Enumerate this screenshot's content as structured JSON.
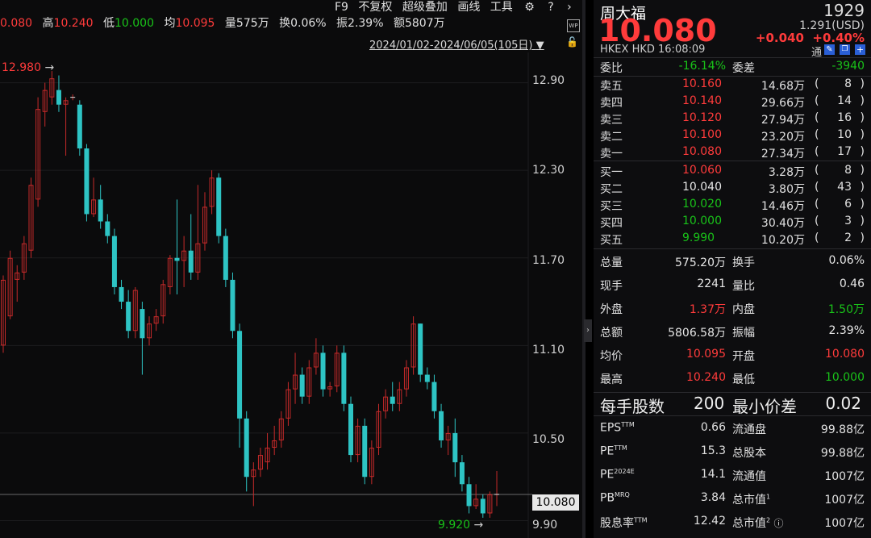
{
  "infobar": {
    "last_label": "",
    "last_value": "0.080",
    "high_label": "高",
    "high_value": "10.240",
    "low_label": "低",
    "low_value": "10.000",
    "avg_label": "均",
    "avg_value": "10.095",
    "vol_label": "量",
    "vol_value": "575万",
    "turn_label": "换",
    "turn_value": "0.06%",
    "amp_label": "振",
    "amp_value": "2.39%",
    "amt_label": "额",
    "amt_value": "5807万"
  },
  "menu": {
    "f9": "F9",
    "adjust": "不复权",
    "overlay": "超级叠加",
    "draw": "画线",
    "tools": "工具"
  },
  "date_range": "2024/01/02-2024/06/05(105日)",
  "price_axis": [
    "12.90",
    "12.30",
    "11.70",
    "11.10",
    "10.50",
    "9.90"
  ],
  "current_price_tag": "10.080",
  "annotations": {
    "max": "12.980",
    "min": "9.920"
  },
  "chart_data": {
    "type": "candlestick",
    "title": "",
    "ylim": [
      9.82,
      13.08
    ],
    "y_ticks": [
      12.9,
      12.3,
      11.7,
      11.1,
      10.5,
      9.9
    ],
    "max_label": 12.98,
    "min_label": 9.92,
    "last": 10.08,
    "candles": [
      [
        11.1,
        11.55,
        11.05,
        11.58
      ],
      [
        11.3,
        11.7,
        11.28,
        11.75
      ],
      [
        11.55,
        11.6,
        11.4,
        11.65
      ],
      [
        11.6,
        11.8,
        11.55,
        11.85
      ],
      [
        11.75,
        12.2,
        11.7,
        12.25
      ],
      [
        12.1,
        12.72,
        12.05,
        12.8
      ],
      [
        12.7,
        12.85,
        12.6,
        12.9
      ],
      [
        12.8,
        12.93,
        12.75,
        12.98
      ],
      [
        12.85,
        12.75,
        12.7,
        12.95
      ],
      [
        12.75,
        12.78,
        12.4,
        12.8
      ],
      [
        12.8,
        12.8,
        12.78,
        12.82
      ],
      [
        12.75,
        12.45,
        12.4,
        12.78
      ],
      [
        12.45,
        12.0,
        11.95,
        12.48
      ],
      [
        12.0,
        12.1,
        11.98,
        12.25
      ],
      [
        12.1,
        11.95,
        11.9,
        12.2
      ],
      [
        11.95,
        11.85,
        11.8,
        12.0
      ],
      [
        11.85,
        11.5,
        11.45,
        11.9
      ],
      [
        11.5,
        11.4,
        11.35,
        11.55
      ],
      [
        11.4,
        11.2,
        11.15,
        11.48
      ],
      [
        11.2,
        11.48,
        11.15,
        11.5
      ],
      [
        11.35,
        11.15,
        10.9,
        11.4
      ],
      [
        11.15,
        11.25,
        11.1,
        11.3
      ],
      [
        11.25,
        11.3,
        11.2,
        11.35
      ],
      [
        11.3,
        11.52,
        11.25,
        11.55
      ],
      [
        11.5,
        11.7,
        11.45,
        11.72
      ],
      [
        11.7,
        11.68,
        11.45,
        12.1
      ],
      [
        11.68,
        11.75,
        11.5,
        11.85
      ],
      [
        11.75,
        11.6,
        11.55,
        12.0
      ],
      [
        11.6,
        11.8,
        11.55,
        12.2
      ],
      [
        11.8,
        12.05,
        11.75,
        12.15
      ],
      [
        12.05,
        12.25,
        12.0,
        12.3
      ],
      [
        12.25,
        11.85,
        11.8,
        12.28
      ],
      [
        11.85,
        11.55,
        11.5,
        11.9
      ],
      [
        11.55,
        11.2,
        11.15,
        11.6
      ],
      [
        11.2,
        10.6,
        10.4,
        11.25
      ],
      [
        10.6,
        10.2,
        10.1,
        10.65
      ],
      [
        10.2,
        10.25,
        10.0,
        10.3
      ],
      [
        10.25,
        10.35,
        10.2,
        10.4
      ],
      [
        10.3,
        10.4,
        10.25,
        10.5
      ],
      [
        10.4,
        10.45,
        10.35,
        10.55
      ],
      [
        10.45,
        10.6,
        10.4,
        10.65
      ],
      [
        10.6,
        10.8,
        10.55,
        10.85
      ],
      [
        10.8,
        10.9,
        10.7,
        11.05
      ],
      [
        10.9,
        10.75,
        10.7,
        10.95
      ],
      [
        10.75,
        10.95,
        10.7,
        11.0
      ],
      [
        10.95,
        11.05,
        10.9,
        11.15
      ],
      [
        11.05,
        10.8,
        10.75,
        11.1
      ],
      [
        10.8,
        10.82,
        10.75,
        10.85
      ],
      [
        10.82,
        11.05,
        10.78,
        11.1
      ],
      [
        11.05,
        10.7,
        10.65,
        11.1
      ],
      [
        10.7,
        10.35,
        10.3,
        10.75
      ],
      [
        10.35,
        10.55,
        10.3,
        10.6
      ],
      [
        10.55,
        10.2,
        10.15,
        10.6
      ],
      [
        10.2,
        10.4,
        10.15,
        10.45
      ],
      [
        10.4,
        10.65,
        10.35,
        10.7
      ],
      [
        10.65,
        10.75,
        10.6,
        10.8
      ],
      [
        10.75,
        10.7,
        10.65,
        10.85
      ],
      [
        10.7,
        10.8,
        10.65,
        10.85
      ],
      [
        10.8,
        10.95,
        10.75,
        11.0
      ],
      [
        10.95,
        11.25,
        10.9,
        11.3
      ],
      [
        11.25,
        10.9,
        10.85,
        11.25
      ],
      [
        10.9,
        10.85,
        10.8,
        10.95
      ],
      [
        10.85,
        10.65,
        10.6,
        10.9
      ],
      [
        10.65,
        10.45,
        10.4,
        10.7
      ],
      [
        10.45,
        10.5,
        10.35,
        10.55
      ],
      [
        10.5,
        10.3,
        10.2,
        10.6
      ],
      [
        10.3,
        10.15,
        10.1,
        10.35
      ],
      [
        10.15,
        10.0,
        9.95,
        10.2
      ],
      [
        10.0,
        10.05,
        9.98,
        10.15
      ],
      [
        10.05,
        9.95,
        9.92,
        10.08
      ],
      [
        9.95,
        10.08,
        9.92,
        10.1
      ],
      [
        10.08,
        10.08,
        10.0,
        10.24
      ]
    ]
  },
  "stock": {
    "name": "周大福",
    "code": "1929",
    "price": "10.080",
    "usd": "1.291(USD)",
    "change": "+0.040",
    "change_pct": "+0.40%",
    "exchange": "HKEX",
    "currency": "HKD",
    "time": "16:08:09",
    "tong": "通"
  },
  "ratio": {
    "l1": "委比",
    "v1": "-16.14%",
    "l2": "委差",
    "v2": "-3940"
  },
  "asks": [
    {
      "label": "卖五",
      "price": "10.160",
      "vol": "14.68万",
      "cnt": "8"
    },
    {
      "label": "卖四",
      "price": "10.140",
      "vol": "29.66万",
      "cnt": "14"
    },
    {
      "label": "卖三",
      "price": "10.120",
      "vol": "27.94万",
      "cnt": "16"
    },
    {
      "label": "卖二",
      "price": "10.100",
      "vol": "23.20万",
      "cnt": "10"
    },
    {
      "label": "卖一",
      "price": "10.080",
      "vol": "27.34万",
      "cnt": "17"
    }
  ],
  "bids": [
    {
      "label": "买一",
      "price": "10.060",
      "vol": "3.28万",
      "cnt": "8"
    },
    {
      "label": "买二",
      "price": "10.040",
      "vol": "3.80万",
      "cnt": "43"
    },
    {
      "label": "买三",
      "price": "10.020",
      "vol": "14.46万",
      "cnt": "6"
    },
    {
      "label": "买四",
      "price": "10.000",
      "vol": "30.40万",
      "cnt": "3"
    },
    {
      "label": "买五",
      "price": "9.990",
      "vol": "10.20万",
      "cnt": "2"
    }
  ],
  "stats": [
    {
      "l1": "总量",
      "v1": "575.20万",
      "l2": "换手",
      "v2": "0.06%"
    },
    {
      "l1": "现手",
      "v1": "2241",
      "l2": "量比",
      "v2": "0.46"
    },
    {
      "l1": "外盘",
      "v1": "1.37万",
      "l2": "内盘",
      "v2": "1.50万"
    },
    {
      "l1": "总额",
      "v1": "5806.58万",
      "l2": "振幅",
      "v2": "2.39%"
    },
    {
      "l1": "均价",
      "v1": "10.095",
      "l2": "开盘",
      "v2": "10.080"
    },
    {
      "l1": "最高",
      "v1": "10.240",
      "l2": "最低",
      "v2": "10.000"
    }
  ],
  "lot": {
    "l1": "每手股数",
    "v1": "200",
    "l2": "最小价差",
    "v2": "0.02"
  },
  "fund": [
    {
      "l1": "EPS",
      "s1": "TTM",
      "v1": "0.66",
      "l2": "流通盘",
      "s2": "",
      "v2": "99.88亿"
    },
    {
      "l1": "PE",
      "s1": "TTM",
      "v1": "15.3",
      "l2": "总股本",
      "s2": "",
      "v2": "99.88亿"
    },
    {
      "l1": "PE",
      "s1": "2024E",
      "v1": "14.1",
      "l2": "流通值",
      "s2": "",
      "v2": "1007亿"
    },
    {
      "l1": "PB",
      "s1": "MRQ",
      "v1": "3.84",
      "l2": "总市值",
      "s2": "1",
      "v2": "1007亿"
    },
    {
      "l1": "股息率",
      "s1": "TTM",
      "v1": "12.42",
      "l2": "总市值",
      "s2": "2",
      "v2": "1007亿"
    }
  ]
}
